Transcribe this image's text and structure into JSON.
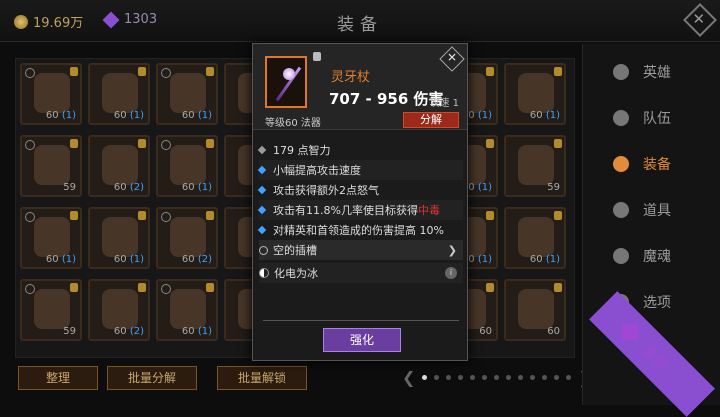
{
  "currency": {
    "gold": "19.69万",
    "gems": "1303"
  },
  "title": "装备",
  "slots": [
    {
      "lvl": "60",
      "sub": "(1)"
    },
    {
      "lvl": "60",
      "sub": "(1)"
    },
    {
      "lvl": "60",
      "sub": "(1)"
    },
    {
      "lvl": "",
      "sub": ""
    },
    {
      "lvl": "",
      "sub": ""
    },
    {
      "lvl": "",
      "sub": ""
    },
    {
      "lvl": "60",
      "sub": "(1)"
    },
    {
      "lvl": "60",
      "sub": "(1)"
    },
    {
      "lvl": "59",
      "sub": ""
    },
    {
      "lvl": "60",
      "sub": "(2)"
    },
    {
      "lvl": "60",
      "sub": "(1)"
    },
    {
      "lvl": "",
      "sub": ""
    },
    {
      "lvl": "",
      "sub": ""
    },
    {
      "lvl": "",
      "sub": ""
    },
    {
      "lvl": "60",
      "sub": "(1)"
    },
    {
      "lvl": "59",
      "sub": ""
    },
    {
      "lvl": "60",
      "sub": "(1)"
    },
    {
      "lvl": "60",
      "sub": "(1)"
    },
    {
      "lvl": "60",
      "sub": "(2)"
    },
    {
      "lvl": "",
      "sub": ""
    },
    {
      "lvl": "",
      "sub": ""
    },
    {
      "lvl": "",
      "sub": ""
    },
    {
      "lvl": "60",
      "sub": "(1)"
    },
    {
      "lvl": "60",
      "sub": "(1)"
    },
    {
      "lvl": "59",
      "sub": ""
    },
    {
      "lvl": "60",
      "sub": "(2)"
    },
    {
      "lvl": "60",
      "sub": "(1)"
    },
    {
      "lvl": "",
      "sub": ""
    },
    {
      "lvl": "",
      "sub": ""
    },
    {
      "lvl": "",
      "sub": ""
    },
    {
      "lvl": "60",
      "sub": ""
    },
    {
      "lvl": "60",
      "sub": ""
    }
  ],
  "bottom_buttons": [
    "整理",
    "批量分解",
    "批量解锁"
  ],
  "sidebar": [
    "英雄",
    "队伍",
    "装备",
    "道具",
    "魔魂",
    "选项",
    "紫晶"
  ],
  "popup": {
    "name": "灵牙杖",
    "damage": "707 - 956 伤害",
    "speed": "攻速 1",
    "level": "等级60 法器",
    "dismantle": "分解",
    "stats": [
      "179 点智力",
      "小幅提高攻击速度",
      "攻击获得额外2点怒气"
    ],
    "stat_poison_prefix": "攻击有11.8%几率使目标获得",
    "stat_poison_word": "中毒",
    "stat_elite": "对精英和首领造成的伤害提高 10%",
    "socket": "空的插槽",
    "transform": "化电为冰",
    "enhance": "强化"
  },
  "colors": {
    "accent": "#e47f2d",
    "gem": "#a047d6",
    "blue": "#3fa3ff",
    "poison": "#e23232"
  }
}
